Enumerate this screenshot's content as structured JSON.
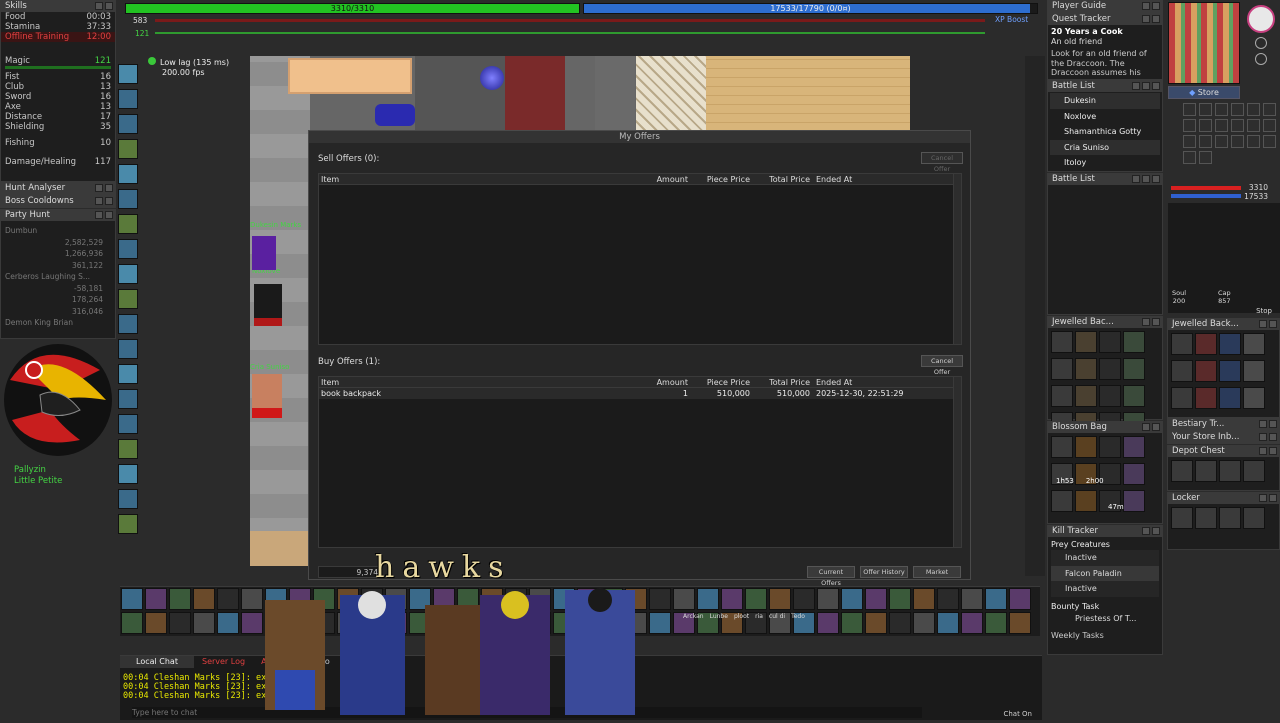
{
  "skills": {
    "title": "Skills",
    "rows": [
      {
        "label": "Food",
        "value": "00:03"
      },
      {
        "label": "Stamina",
        "value": "37:33"
      },
      {
        "label": "Offline Training",
        "value": "12:00"
      }
    ],
    "magic": {
      "label": "Magic",
      "value": "121"
    },
    "melee": [
      {
        "label": "Fist",
        "value": "16"
      },
      {
        "label": "Club",
        "value": "13"
      },
      {
        "label": "Sword",
        "value": "16"
      },
      {
        "label": "Axe",
        "value": "13"
      },
      {
        "label": "Distance",
        "value": "17"
      },
      {
        "label": "Shielding",
        "value": "35"
      }
    ],
    "fishing": {
      "label": "Fishing",
      "value": "10"
    },
    "damage": {
      "label": "Damage/Healing",
      "value": "117"
    }
  },
  "left_panels": {
    "hunt_analyser": "Hunt Analyser",
    "boss_cooldowns": "Boss Cooldowns",
    "party_hunt": "Party Hunt",
    "party_entries": [
      {
        "name": "Dumbun",
        "value": ""
      },
      {
        "name": "",
        "value": "2,582,529"
      },
      {
        "name": "",
        "value": "1,266,936"
      },
      {
        "name": "",
        "value": "361,122"
      },
      {
        "name": "Cerberos Laughing S...",
        "value": ""
      },
      {
        "name": "",
        "value": "-58,181"
      },
      {
        "name": "",
        "value": "178,264"
      },
      {
        "name": "",
        "value": "316,046"
      },
      {
        "name": "Demon King Brian",
        "value": ""
      }
    ],
    "party_names": [
      "Pallyzin",
      "Little Petite"
    ]
  },
  "status": {
    "health_text": "3310/3310",
    "health_fill": 1.0,
    "mana_text": "17533/17790 (0/0¤)",
    "mana_fill": 0.985,
    "level_a": "583",
    "level_b": "121",
    "xp_boost": "XP Boost",
    "lag": "Low lag (135 ms)",
    "fps": "200.00 fps"
  },
  "map_labels": [
    "Dukesin Marks",
    "Noxlove",
    "Cria Suniso"
  ],
  "market": {
    "title": "My Offers",
    "sell_label": "Sell Offers (0):",
    "buy_label": "Buy Offers (1):",
    "cancel_offer": "Cancel Offer",
    "columns": {
      "item": "Item",
      "amount": "Amount",
      "piece": "Piece Price",
      "total": "Total Price",
      "ended": "Ended At"
    },
    "buy_rows": [
      {
        "item": "book backpack",
        "amount": "1",
        "piece": "510,000",
        "total": "510,000",
        "ended": "2025-12-30, 22:51:29"
      }
    ],
    "balance": "9,374",
    "btn_current": "Current Offers",
    "btn_history": "Offer History",
    "btn_market": "Market"
  },
  "watermark": "hawks",
  "chat": {
    "tabs": [
      "Local Chat",
      "Server Log",
      "Adv",
      "Wo",
      "Lo"
    ],
    "lines": [
      "00:04 Cleshan Marks [23]: exura gr",
      "00:04 Cleshan Marks [23]: exura gr",
      "00:04 Cleshan Marks [23]: exura gr"
    ],
    "placeholder": "Type here to chat",
    "chat_on": "Chat On"
  },
  "right_mid": {
    "player_guide": "Player Guide",
    "quest_tracker": "Quest Tracker",
    "quest_title": "20 Years a Cook",
    "quest_sub": "An old friend",
    "quest_desc": "Look for an old friend of the Draccoon. The Draccoon assumes his",
    "battle_list": "Battle List",
    "battle_entries": [
      "Dukesin",
      "Noxlove",
      "Shamanthica Gotty",
      "Cria Suniso",
      "Itoloy"
    ],
    "battle_list2": "Battle List",
    "jewelled_back": "Jewelled Bac...",
    "blossom_bag": "Blossom Bag",
    "blossom_labels": [
      "1h53",
      "2h00",
      "47m"
    ],
    "kill_tracker": "Kill Tracker",
    "prey_creatures": "Prey Creatures",
    "prey": [
      "Inactive",
      "Falcon Paladin",
      "Inactive"
    ],
    "bounty_task": "Bounty Task",
    "bounty_target": "Priestess Of T...",
    "weekly_tasks": "Weekly Tasks"
  },
  "right_far": {
    "store": "Store",
    "hp": "3310",
    "mp": "17533",
    "soul": "200",
    "cap": "857",
    "stop": "Stop",
    "jewelled_back": "Jewelled Back...",
    "bestiary": "Bestiary Tr...",
    "your_store": "Your Store Inb...",
    "depot_chest": "Depot Chest",
    "locker": "Locker"
  },
  "hotbar_labels": [
    "Arckan",
    "Lunbe",
    "ploot",
    "ria",
    "cul di",
    "Tedo"
  ],
  "colors": {
    "health": "#22c322",
    "mana": "#2d6dd0",
    "accent_green": "#44d444",
    "xp_boost": "#6fa0ff"
  }
}
